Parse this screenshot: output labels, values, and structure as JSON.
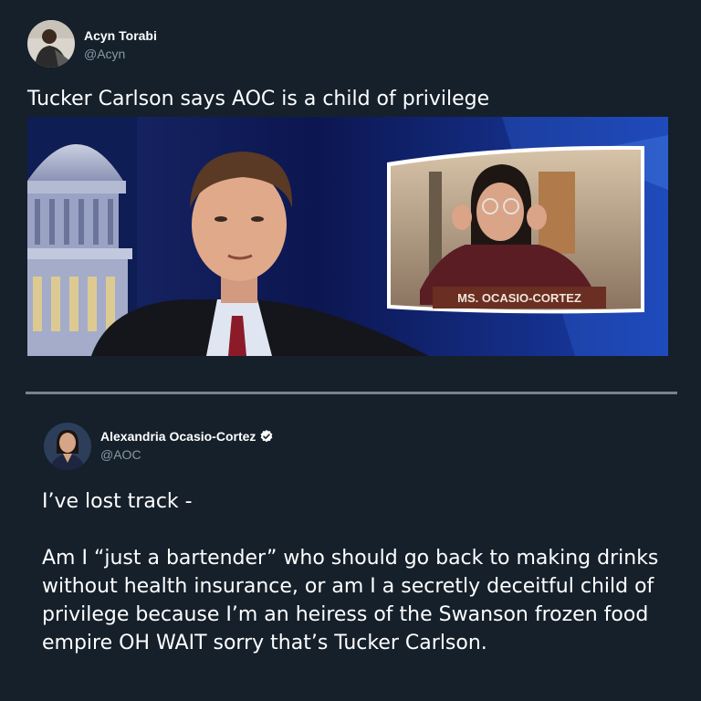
{
  "tweet1": {
    "author_name": "Acyn Torabi",
    "author_handle": "@Acyn",
    "text": "Tucker Carlson says AOC is a child of privilege",
    "media": {
      "nameplate": "MS. OCASIO-CORTEZ"
    }
  },
  "tweet2": {
    "author_name": "Alexandria Ocasio-Cortez",
    "author_handle": "@AOC",
    "verified": true,
    "text": "I’ve lost track -\n\nAm I “just a bartender” who should go back to making drinks without health insurance, or am I a secretly deceitful child of privilege because I’m an heiress of the Swanson frozen food empire OH WAIT sorry that’s Tucker Carlson."
  },
  "colors": {
    "background": "#15202b",
    "handle": "#8899a6",
    "divider": "#7a828c",
    "verified": "#ffffff"
  }
}
